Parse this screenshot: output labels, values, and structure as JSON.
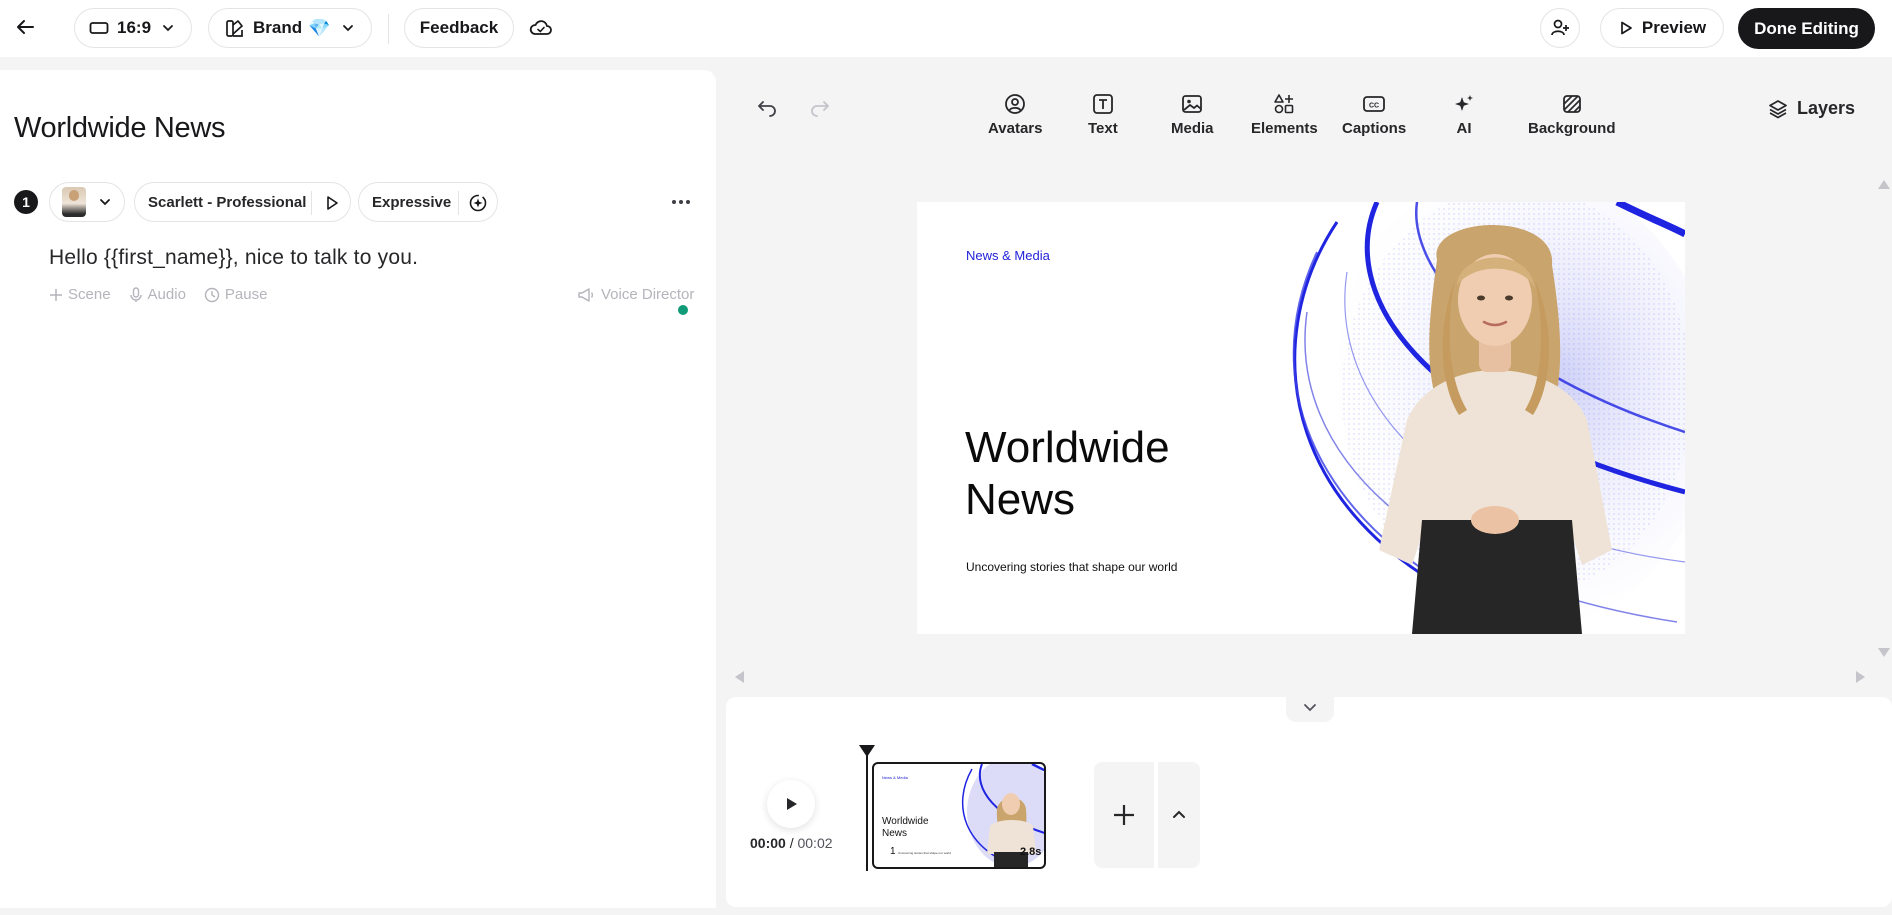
{
  "topbar": {
    "aspect_ratio": "16:9",
    "brand_label": "Brand",
    "brand_emoji": "💎",
    "feedback_label": "Feedback",
    "preview_label": "Preview",
    "done_label": "Done Editing"
  },
  "script_panel": {
    "title": "Worldwide News",
    "scene_number": "1",
    "voice_name": "Scarlett - Professional",
    "voice_style": "Expressive",
    "script_text": "Hello {{first_name}}, nice to talk to you.",
    "actions": [
      {
        "icon": "plus-icon",
        "label": "Scene"
      },
      {
        "icon": "microphone-icon",
        "label": "Audio"
      },
      {
        "icon": "pause-clock-icon",
        "label": "Pause"
      }
    ],
    "voice_director_label": "Voice Director",
    "status_color": "#0f9b77"
  },
  "toolbar": {
    "tools": [
      {
        "icon": "avatar-icon",
        "label": "Avatars"
      },
      {
        "icon": "text-icon",
        "label": "Text"
      },
      {
        "icon": "image-icon",
        "label": "Media"
      },
      {
        "icon": "elements-icon",
        "label": "Elements"
      },
      {
        "icon": "captions-icon",
        "label": "Captions"
      },
      {
        "icon": "sparkle-icon",
        "label": "AI"
      },
      {
        "icon": "background-icon",
        "label": "Background"
      }
    ],
    "layers_label": "Layers"
  },
  "canvas": {
    "tag": "News & Media",
    "title": "Worldwide News",
    "subtitle": "Uncovering stories that shape our world",
    "accent_color": "#2222d8"
  },
  "timeline": {
    "current_time": "00:00",
    "separator": "/",
    "total_time": "00:02",
    "scene": {
      "number": "1",
      "duration": "2.8s",
      "tag": "News & Media",
      "title": "Worldwide News",
      "subtitle": "Uncovering stories that shape our world"
    }
  }
}
